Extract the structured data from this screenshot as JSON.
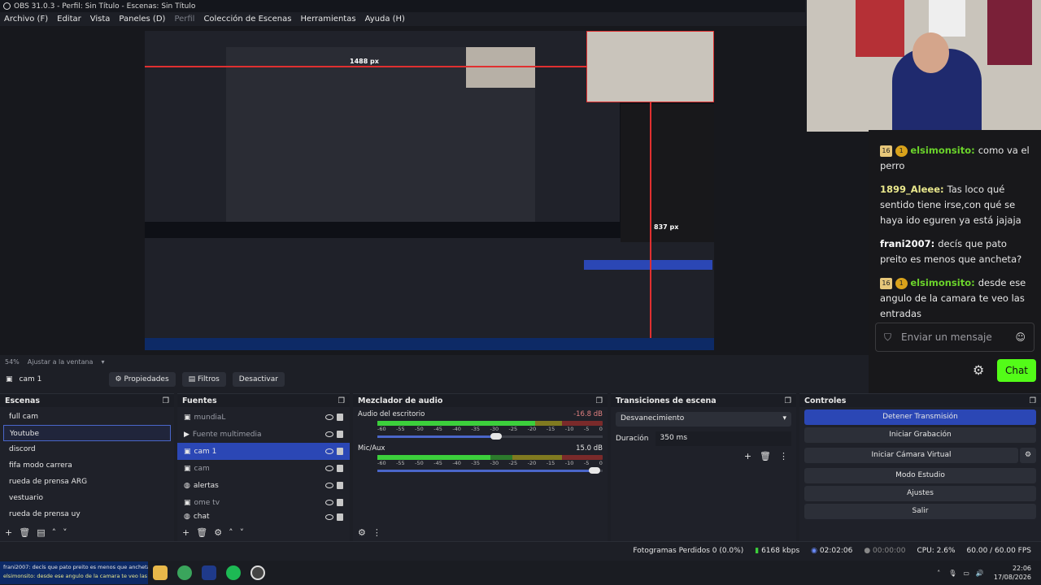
{
  "window": {
    "title": "OBS 31.0.3 - Perfil: Sin Título - Escenas: Sin Título"
  },
  "menu": [
    "Archivo (F)",
    "Editar",
    "Vista",
    "Paneles (D)",
    "Perfil",
    "Colección de Escenas",
    "Herramientas",
    "Ayuda (H)"
  ],
  "preview": {
    "zoom_label": "54%",
    "fit_label": "Ajustar a la ventana",
    "px_top": "1488 px",
    "px_right": "837 px"
  },
  "source_toolbar": {
    "selected_source": "cam 1",
    "properties": "Propiedades",
    "filters": "Filtros",
    "deactivate": "Desactivar"
  },
  "scenes": {
    "title": "Escenas",
    "items": [
      "full cam",
      "Youtube",
      "discord",
      "fifa modo carrera",
      "rueda de prensa ARG",
      "vestuario",
      "rueda de prensa uy"
    ],
    "selected": 1
  },
  "sources": {
    "title": "Fuentes",
    "items": [
      {
        "name": "mundiaL",
        "dim": true
      },
      {
        "name": "Fuente multimedia",
        "dim": true
      },
      {
        "name": "cam 1",
        "dim": false
      },
      {
        "name": "cam",
        "dim": true
      },
      {
        "name": "alertas",
        "dim": false
      },
      {
        "name": "ome tv",
        "dim": true
      },
      {
        "name": "chat",
        "dim": false
      }
    ],
    "selected": 2
  },
  "mixer": {
    "title": "Mezclador de audio",
    "channels": [
      {
        "name": "Audio del escritorio",
        "db": "-16.8 dB",
        "level": 0.7
      },
      {
        "name": "Mic/Aux",
        "db": "15.0 dB",
        "level": 0.5
      }
    ],
    "scale": [
      "-60",
      "-55",
      "-50",
      "-45",
      "-40",
      "-35",
      "-30",
      "-25",
      "-20",
      "-15",
      "-10",
      "-5",
      "0"
    ]
  },
  "transitions": {
    "title": "Transiciones de escena",
    "selected": "Desvanecimiento",
    "duration_label": "Duración",
    "duration_value": "350 ms"
  },
  "controls": {
    "title": "Controles",
    "buttons": [
      "Detener Transmisión",
      "Iniciar Grabación",
      "Iniciar Cámara Virtual",
      "Modo Estudio",
      "Ajustes",
      "Salir"
    ]
  },
  "status": {
    "dropped": "Fotogramas Perdidos 0 (0.0%)",
    "bitrate": "6168 kbps",
    "stream_time": "02:02:06",
    "rec_time": "00:00:00",
    "cpu": "CPU: 2.6%",
    "fps": "60.00 / 60.00 FPS"
  },
  "chat": {
    "messages": [
      {
        "badges": [
          "16",
          "1"
        ],
        "user": "elsimonsito",
        "color": "green",
        "text": "como va el perro"
      },
      {
        "badges": [],
        "user": "1899_Aleee",
        "color": "yellow",
        "text": "Tas loco qué sentido tiene irse,con qué se haya ido eguren ya está jajaja"
      },
      {
        "badges": [],
        "user": "frani2007",
        "color": "white",
        "text": "decís que pato preito es menos que ancheta?"
      },
      {
        "badges": [
          "16",
          "1"
        ],
        "user": "elsimonsito",
        "color": "green",
        "text": "desde ese angulo de la camara te veo las entradas"
      }
    ],
    "input_placeholder": "Enviar un mensaje",
    "send_label": "Chat"
  },
  "taskbar": {
    "ticker_line1": "frani2007: decís que pato preito es menos que ancheta?",
    "ticker_line2": "elsimonsito: desde ese angulo de la camara te veo las entradas",
    "time": "22:06",
    "date": "17/08/2026"
  }
}
